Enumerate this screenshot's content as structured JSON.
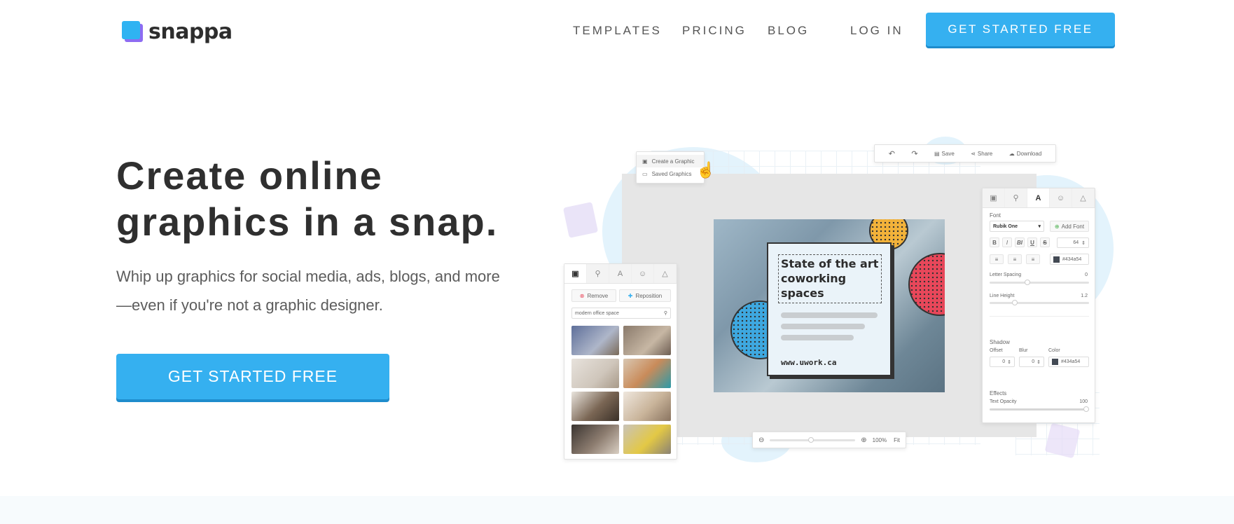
{
  "header": {
    "logo_text": "snappa",
    "nav": [
      "TEMPLATES",
      "PRICING",
      "BLOG"
    ],
    "login": "LOG IN",
    "cta": "GET STARTED FREE"
  },
  "hero": {
    "title_line1": "Create online",
    "title_line2": "graphics in a snap.",
    "subtitle_line1": "Whip up graphics for social media, ads, blogs, and more",
    "subtitle_line2": "—even if you're not a graphic designer.",
    "cta": "GET STARTED FREE"
  },
  "mockup": {
    "popup": {
      "create": "Create a Graphic",
      "saved": "Saved Graphics"
    },
    "toolbar": {
      "save": "Save",
      "share": "Share",
      "download": "Download"
    },
    "left_panel": {
      "tabs": [
        "▣",
        "⚲",
        "A",
        "☺",
        "△"
      ],
      "remove": "Remove",
      "reposition": "Reposition",
      "search_value": "modern office space"
    },
    "right_panel": {
      "tabs": [
        "▣",
        "⚲",
        "A",
        "☺",
        "△"
      ],
      "font_label": "Font",
      "font_value": "Rubik One",
      "add_font": "Add Font",
      "style_buttons": [
        "B",
        "I",
        "BI",
        "U",
        "S"
      ],
      "font_size": "64",
      "color_hex": "#434a54",
      "letter_spacing_label": "Letter Spacing",
      "letter_spacing_value": "0",
      "line_height_label": "Line Height",
      "line_height_value": "1.2",
      "shadow_label": "Shadow",
      "offset_label": "Offset",
      "blur_label": "Blur",
      "color_label": "Color",
      "offset_value": "0",
      "blur_value": "0",
      "shadow_color": "#434a54",
      "effects_label": "Effects",
      "text_opacity_label": "Text Opacity",
      "text_opacity_value": "100"
    },
    "design": {
      "title": "State of the art coworking spaces",
      "url": "www.uwork.ca"
    },
    "zoom": {
      "value": "100%",
      "fit": "Fit"
    }
  },
  "colors": {
    "brand_blue": "#35b0f0",
    "logo_purple": "#8d6cf2",
    "dot_blue": "#3ea8e0",
    "dot_yellow": "#f2b23a",
    "dot_red": "#e8475a"
  }
}
